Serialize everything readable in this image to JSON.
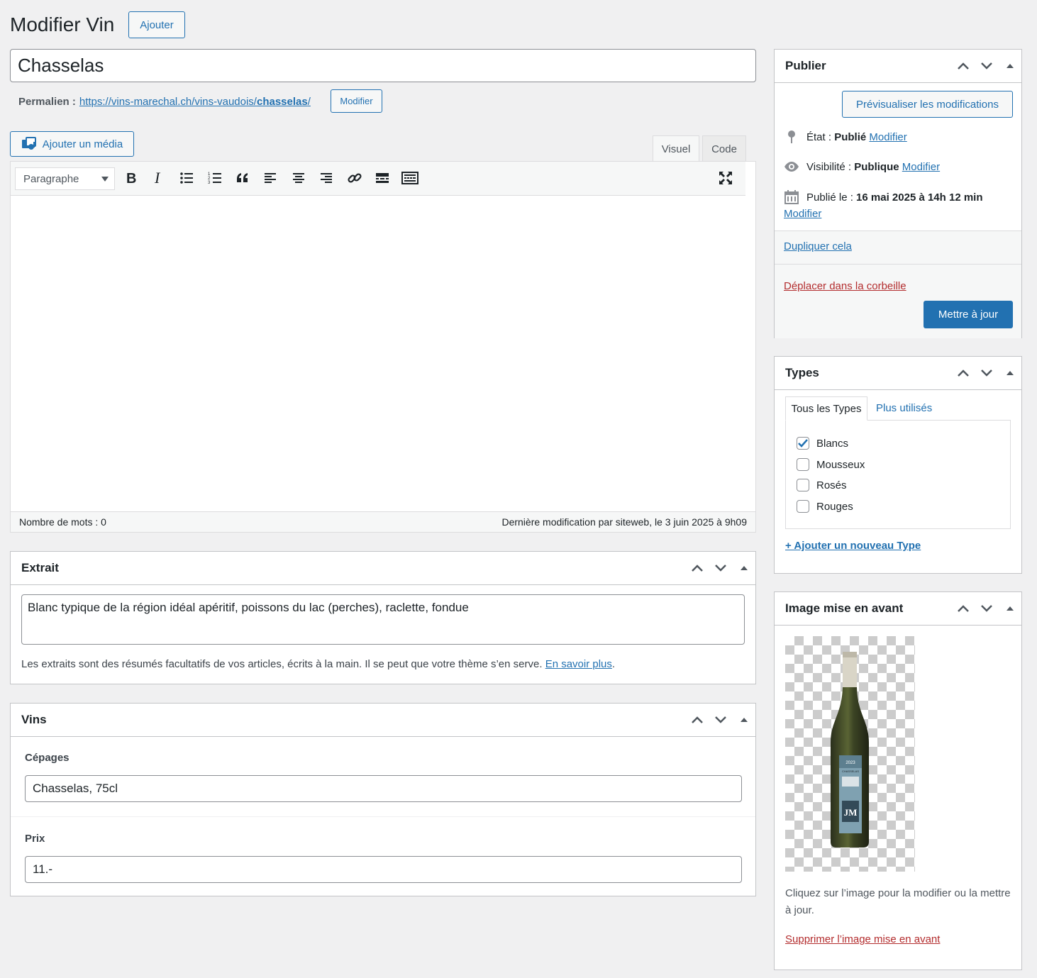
{
  "header": {
    "title": "Modifier Vin",
    "add_button": "Ajouter"
  },
  "post": {
    "title": "Chasselas",
    "permalink_label": "Permalien :",
    "permalink_base": "https://vins-marechal.ch/vins-vaudois/",
    "permalink_slug": "chasselas",
    "permalink_end": "/",
    "permalink_edit": "Modifier"
  },
  "editor": {
    "add_media": "Ajouter un média",
    "tab_visual": "Visuel",
    "tab_code": "Code",
    "format_select": "Paragraphe",
    "word_count": "Nombre de mots : 0",
    "last_modified": "Dernière modification par siteweb, le 3 juin 2025 à 9h09"
  },
  "excerpt": {
    "title": "Extrait",
    "value": "Blanc typique de la région idéal apéritif, poissons du lac (perches), raclette, fondue",
    "help": "Les extraits sont des résumés facultatifs de vos articles, écrits à la main. Il se peut que votre thème s’en serve.",
    "help_link": "En savoir plus",
    "help_end": "."
  },
  "vins": {
    "title": "Vins",
    "cepages_label": "Cépages",
    "cepages_value": "Chasselas, 75cl",
    "prix_label": "Prix",
    "prix_value": "11.-"
  },
  "publish": {
    "title": "Publier",
    "preview": "Prévisualiser les modifications",
    "status_label": "État :",
    "status_value": "Publié",
    "visibility_label": "Visibilité :",
    "visibility_value": "Publique",
    "published_label": "Publié le :",
    "published_value": "16 mai 2025 à 14h 12 min",
    "edit": "Modifier",
    "duplicate": "Dupliquer cela",
    "trash": "Déplacer dans la corbeille",
    "update": "Mettre à jour"
  },
  "types": {
    "title": "Types",
    "tab_all": "Tous les Types",
    "tab_popular": "Plus utilisés",
    "items": [
      {
        "label": "Blancs",
        "checked": true
      },
      {
        "label": "Mousseux",
        "checked": false
      },
      {
        "label": "Rosés",
        "checked": false
      },
      {
        "label": "Rouges",
        "checked": false
      }
    ],
    "add_new": "+ Ajouter un nouveau Type"
  },
  "featured": {
    "title": "Image mise en avant",
    "help": "Cliquez sur l’image pour la modifier ou la mettre à jour.",
    "remove": "Supprimer l’image mise en avant",
    "label_line1": "2023",
    "label_line2": "CHASSELAS",
    "label_mark": "JM"
  },
  "colors": {
    "accent": "#2271b1",
    "danger": "#b32d2e",
    "primary_button": "#2271b1"
  }
}
